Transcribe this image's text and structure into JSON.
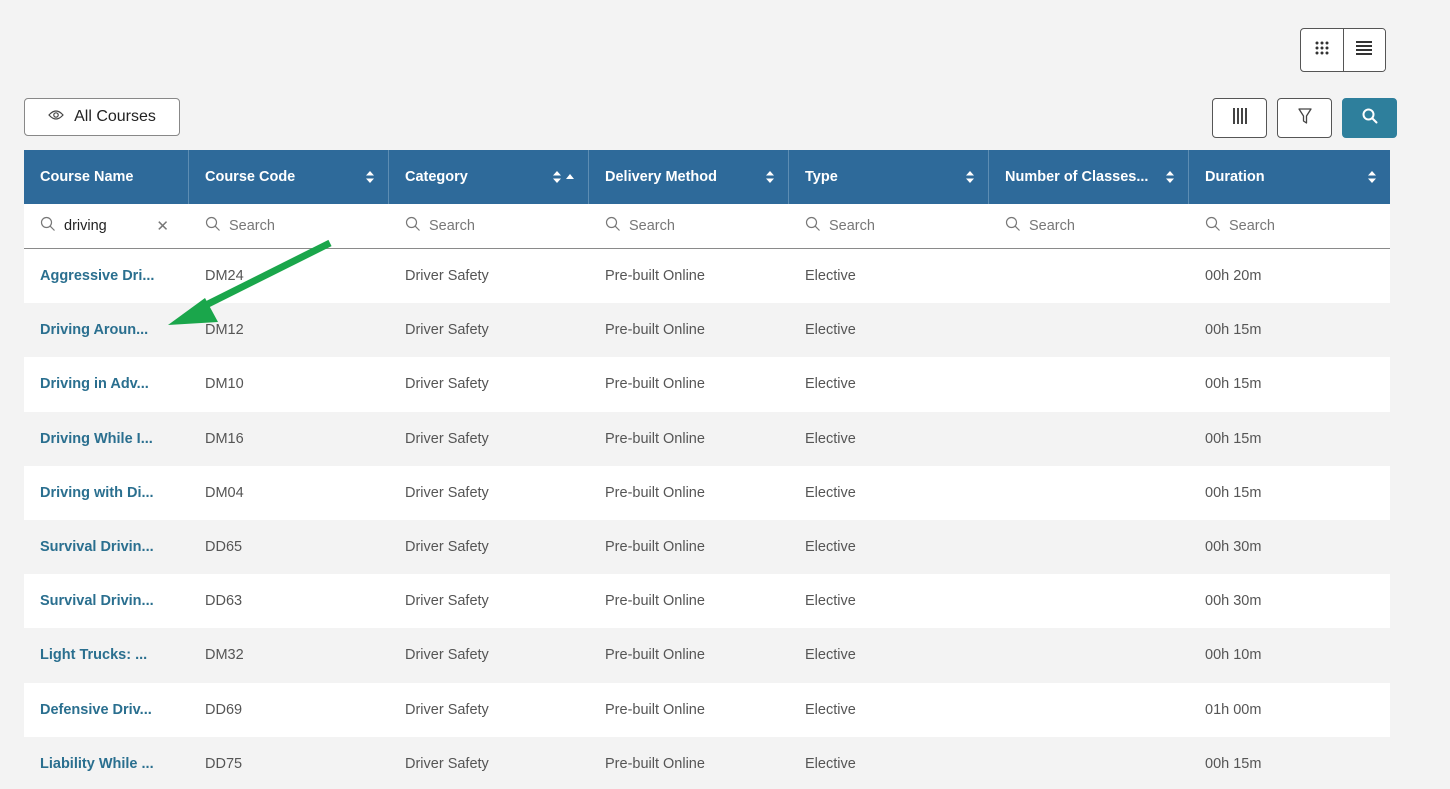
{
  "header": {
    "all_courses_label": "All Courses"
  },
  "icons": {
    "grid_view": "grid-view-icon",
    "list_view": "list-view-icon",
    "eye": "eye-icon",
    "columns": "columns-icon",
    "filter": "filter-icon",
    "search": "search-icon",
    "sort": "sort-icon",
    "clear": "close-icon"
  },
  "colors": {
    "header_bg": "#2e6a9a",
    "primary_btn": "#2e7f9c",
    "link": "#2a6f8f",
    "annotation_arrow": "#1aa64b"
  },
  "table": {
    "columns": [
      "Course Name",
      "Course Code",
      "Category",
      "Delivery Method",
      "Type",
      "Number of Classes...",
      "Duration"
    ],
    "filters": {
      "course_name_value": "driving",
      "placeholder": "Search"
    },
    "rows": [
      {
        "name": "Aggressive Dri...",
        "code": "DM24",
        "category": "Driver Safety",
        "delivery": "Pre-built Online",
        "type": "Elective",
        "classes": "",
        "duration": "00h 20m"
      },
      {
        "name": "Driving Aroun...",
        "code": "DM12",
        "category": "Driver Safety",
        "delivery": "Pre-built Online",
        "type": "Elective",
        "classes": "",
        "duration": "00h 15m"
      },
      {
        "name": "Driving in Adv...",
        "code": "DM10",
        "category": "Driver Safety",
        "delivery": "Pre-built Online",
        "type": "Elective",
        "classes": "",
        "duration": "00h 15m"
      },
      {
        "name": "Driving While I...",
        "code": "DM16",
        "category": "Driver Safety",
        "delivery": "Pre-built Online",
        "type": "Elective",
        "classes": "",
        "duration": "00h 15m"
      },
      {
        "name": "Driving with Di...",
        "code": "DM04",
        "category": "Driver Safety",
        "delivery": "Pre-built Online",
        "type": "Elective",
        "classes": "",
        "duration": "00h 15m"
      },
      {
        "name": "Survival Drivin...",
        "code": "DD65",
        "category": "Driver Safety",
        "delivery": "Pre-built Online",
        "type": "Elective",
        "classes": "",
        "duration": "00h 30m"
      },
      {
        "name": "Survival Drivin...",
        "code": "DD63",
        "category": "Driver Safety",
        "delivery": "Pre-built Online",
        "type": "Elective",
        "classes": "",
        "duration": "00h 30m"
      },
      {
        "name": "Light Trucks: ...",
        "code": "DM32",
        "category": "Driver Safety",
        "delivery": "Pre-built Online",
        "type": "Elective",
        "classes": "",
        "duration": "00h 10m"
      },
      {
        "name": "Defensive Driv...",
        "code": "DD69",
        "category": "Driver Safety",
        "delivery": "Pre-built Online",
        "type": "Elective",
        "classes": "",
        "duration": "01h 00m"
      },
      {
        "name": "Liability While ...",
        "code": "DD75",
        "category": "Driver Safety",
        "delivery": "Pre-built Online",
        "type": "Elective",
        "classes": "",
        "duration": "00h 15m"
      }
    ]
  }
}
